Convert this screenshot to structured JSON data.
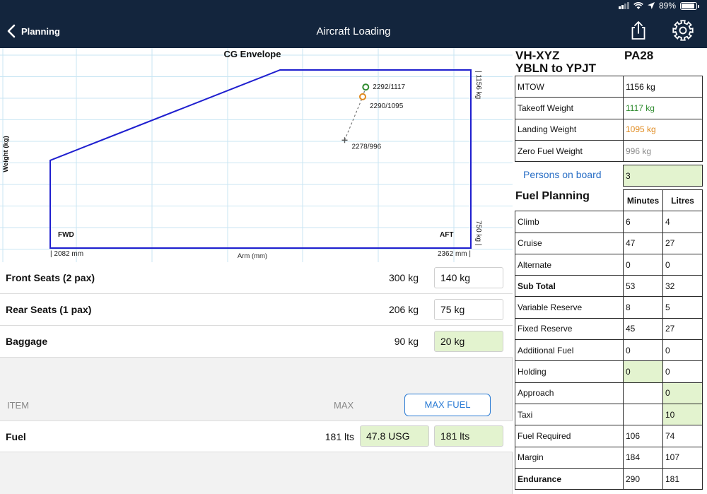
{
  "status": {
    "battery": "89%"
  },
  "nav": {
    "back_label": "Planning",
    "title": "Aircraft Loading"
  },
  "chart_data": {
    "type": "scatter",
    "title": "CG Envelope",
    "xlabel": "Arm (mm)",
    "ylabel": "Weight (kg)",
    "xlim": [
      2082,
      2362
    ],
    "ylim": [
      750,
      1156
    ],
    "x_min_label": "| 2082 mm",
    "x_max_label": "2362 mm |",
    "y_max_label": "| 1156 kg",
    "y_min_label": "750 kg |",
    "fwd_label": "FWD",
    "aft_label": "AFT",
    "envelope": [
      {
        "x": 2082,
        "y": 750
      },
      {
        "x": 2082,
        "y": 950
      },
      {
        "x": 2235,
        "y": 1156
      },
      {
        "x": 2362,
        "y": 1156
      },
      {
        "x": 2362,
        "y": 750
      }
    ],
    "points": [
      {
        "label": "2292/1117",
        "x": 2292,
        "y": 1117,
        "color": "#2e8b2e",
        "marker": "circle"
      },
      {
        "label": "2290/1095",
        "x": 2290,
        "y": 1095,
        "color": "#e08a1e",
        "marker": "circle"
      },
      {
        "label": "2278/996",
        "x": 2278,
        "y": 996,
        "color": "#555555",
        "marker": "plus"
      }
    ],
    "envelope_color": "#1f1fcf",
    "grid": true
  },
  "loads": [
    {
      "label": "Front Seats (2 pax)",
      "max": "300 kg",
      "value": "140 kg",
      "highlight": false
    },
    {
      "label": "Rear Seats (1 pax)",
      "max": "206 kg",
      "value": "75 kg",
      "highlight": false
    },
    {
      "label": "Baggage",
      "max": "90 kg",
      "value": "20 kg",
      "highlight": true
    }
  ],
  "fuel_section": {
    "item_header": "ITEM",
    "max_header": "MAX",
    "max_fuel_button": "MAX FUEL",
    "fuel_label": "Fuel",
    "fuel_max": "181 lts",
    "fuel_usg": "47.8 USG",
    "fuel_lts": "181 lts"
  },
  "aircraft": {
    "registration": "VH-XYZ",
    "type": "PA28",
    "route": "YBLN to YPJT"
  },
  "weights": [
    {
      "label": "MTOW",
      "value": "1156 kg",
      "color": "#111111"
    },
    {
      "label": "Takeoff Weight",
      "value": "1117 kg",
      "color": "#2e8b2e"
    },
    {
      "label": "Landing Weight",
      "value": "1095 kg",
      "color": "#e08a1e"
    },
    {
      "label": "Zero Fuel Weight",
      "value": "996 kg",
      "color": "#8a8a8a"
    }
  ],
  "persons": {
    "label": "Persons on board",
    "value": "3"
  },
  "fuel_planning": {
    "title": "Fuel Planning",
    "col_minutes": "Minutes",
    "col_litres": "Litres",
    "rows": [
      {
        "label": "Climb",
        "minutes": "6",
        "litres": "4",
        "bold": false,
        "min_green": false,
        "lit_green": false
      },
      {
        "label": "Cruise",
        "minutes": "47",
        "litres": "27",
        "bold": false,
        "min_green": false,
        "lit_green": false
      },
      {
        "label": "Alternate",
        "minutes": "0",
        "litres": "0",
        "bold": false,
        "min_green": false,
        "lit_green": false
      },
      {
        "label": "Sub Total",
        "minutes": "53",
        "litres": "32",
        "bold": true,
        "min_green": false,
        "lit_green": false
      },
      {
        "label": "Variable Reserve",
        "minutes": "8",
        "litres": "5",
        "bold": false,
        "min_green": false,
        "lit_green": false
      },
      {
        "label": "Fixed Reserve",
        "minutes": "45",
        "litres": "27",
        "bold": false,
        "min_green": false,
        "lit_green": false
      },
      {
        "label": "Additional Fuel",
        "minutes": "0",
        "litres": "0",
        "bold": false,
        "min_green": false,
        "lit_green": false
      },
      {
        "label": "Holding",
        "minutes": "0",
        "litres": "0",
        "bold": false,
        "min_green": true,
        "lit_green": false
      },
      {
        "label": "Approach",
        "minutes": "",
        "litres": "0",
        "bold": false,
        "min_green": false,
        "lit_green": true
      },
      {
        "label": "Taxi",
        "minutes": "",
        "litres": "10",
        "bold": false,
        "min_green": false,
        "lit_green": true
      },
      {
        "label": "Fuel Required",
        "minutes": "106",
        "litres": "74",
        "bold": false,
        "min_green": false,
        "lit_green": false
      },
      {
        "label": "Margin",
        "minutes": "184",
        "litres": "107",
        "bold": false,
        "min_green": false,
        "lit_green": false
      },
      {
        "label": "Endurance",
        "minutes": "290",
        "litres": "181",
        "bold": true,
        "min_green": false,
        "lit_green": false
      }
    ]
  }
}
